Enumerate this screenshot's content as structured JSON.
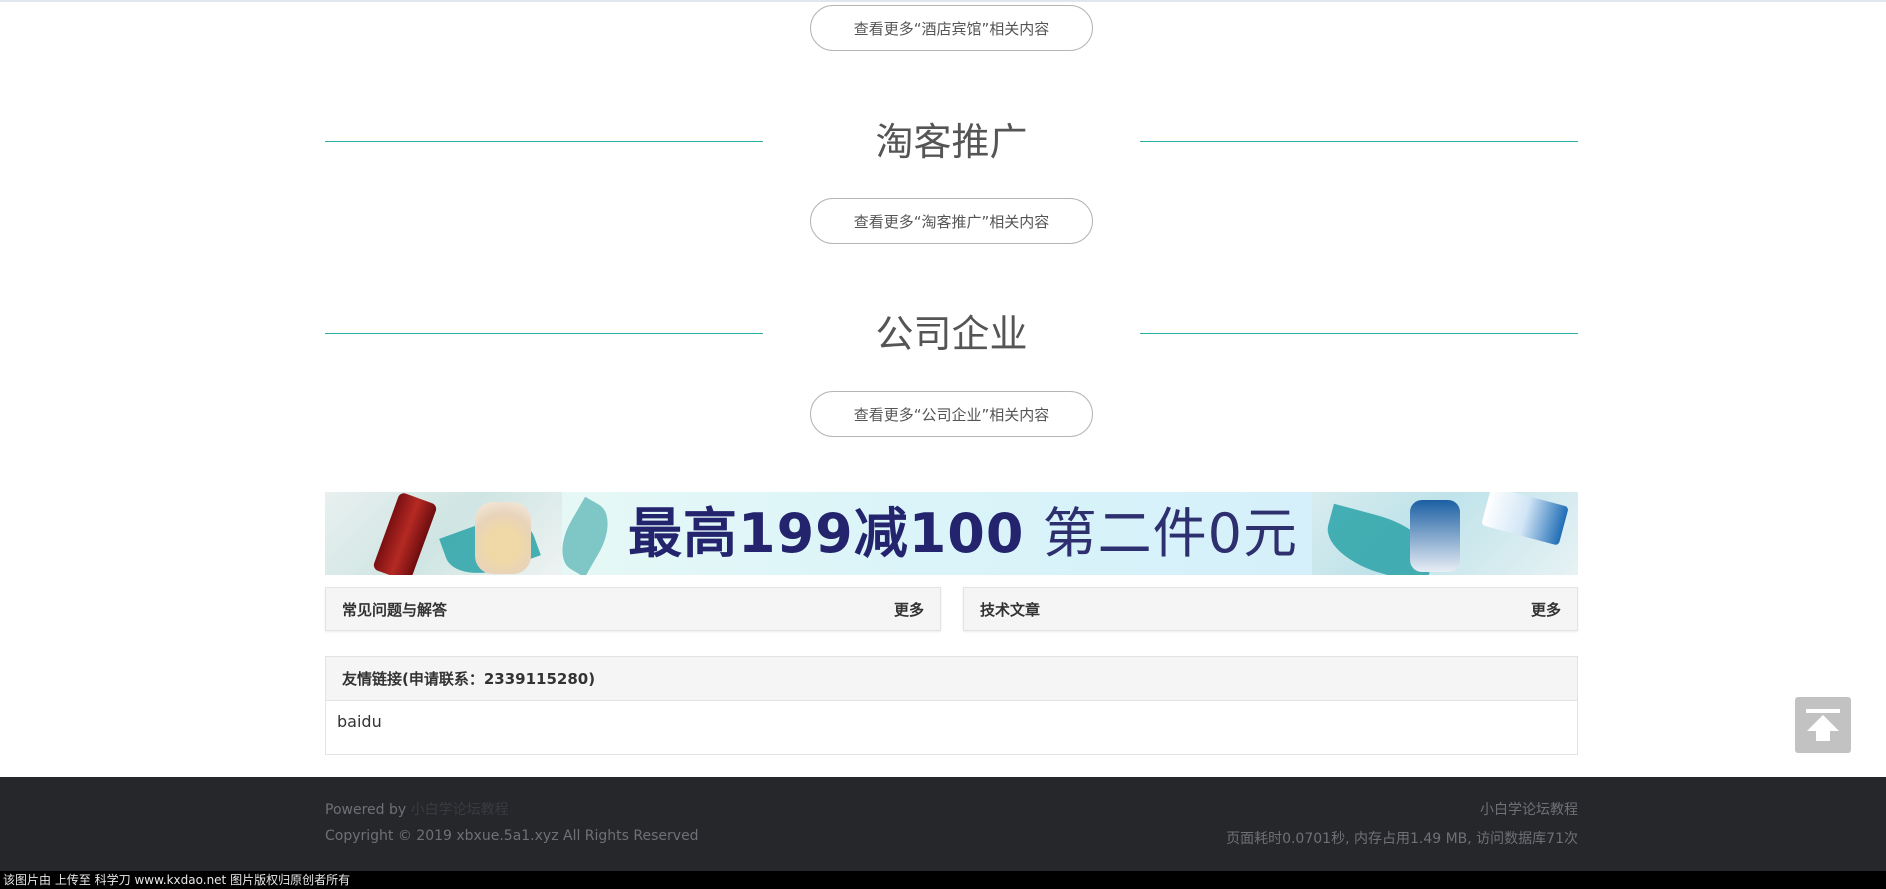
{
  "sections": [
    {
      "more_label": "查看更多“酒店宾馆”相关内容"
    },
    {
      "title": "淘客推广",
      "more_label": "查看更多“淘客推广”相关内容"
    },
    {
      "title": "公司企业",
      "more_label": "查看更多“公司企业”相关内容"
    }
  ],
  "banner": {
    "promo_bold": "最高199减100",
    "promo_light": "第二件0元"
  },
  "panels": {
    "faq": {
      "label": "常见问题与解答",
      "more": "更多"
    },
    "tech": {
      "label": "技术文章",
      "more": "更多"
    }
  },
  "friend_links": {
    "title": "友情链接(申请联系：2339115280)",
    "items": [
      "baidu"
    ]
  },
  "footer": {
    "powered_prefix": "Powered by",
    "powered_link": "小白学论坛教程",
    "copyright": "Copyright © 2019 xbxue.5a1.xyz All Rights Reserved",
    "site_name": "小白学论坛教程",
    "stats": "页面耗时0.0701秒, 内存占用1.49 MB, 访问数据库71次"
  },
  "watermark": "该图片由   上传至  科学刀  www.kxdao.net  图片版权归原创者所有",
  "colors": {
    "accent_line": "#2ab0a5",
    "footer_bg": "#26272b",
    "banner_text": "#23246d"
  },
  "icons": {
    "back_to_top": "arrow-up-to-line-icon"
  }
}
